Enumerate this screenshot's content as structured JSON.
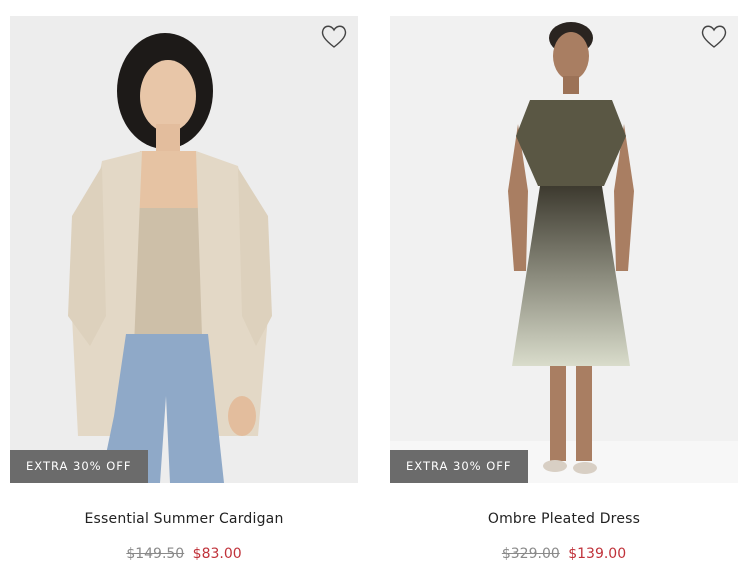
{
  "products": [
    {
      "name": "Essential Summer Cardigan",
      "badge": "EXTRA 30% OFF",
      "original_price": "$149.50",
      "sale_price": "$83.00",
      "wishlist_icon": "heart-outline-icon"
    },
    {
      "name": "Ombre Pleated Dress",
      "badge": "EXTRA 30% OFF",
      "original_price": "$329.00",
      "sale_price": "$139.00",
      "wishlist_icon": "heart-outline-icon"
    }
  ],
  "colors": {
    "badge_bg": "#6b6b6b",
    "sale_price": "#c0323a",
    "original_price": "#8a8a8a"
  }
}
